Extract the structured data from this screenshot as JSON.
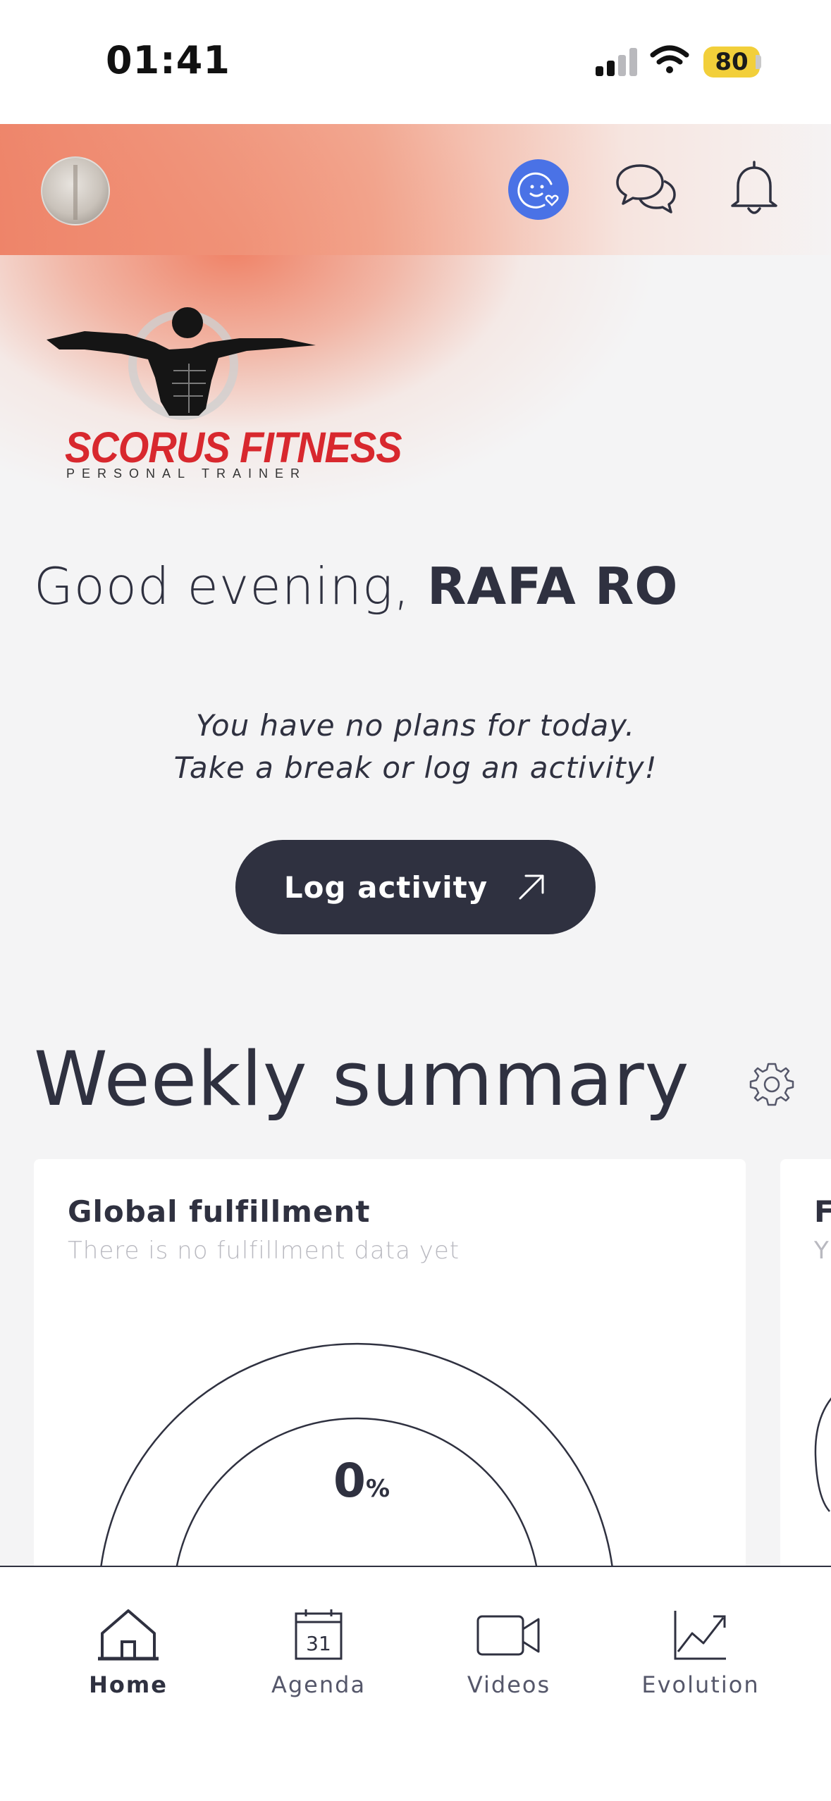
{
  "status_bar": {
    "time": "01:41",
    "battery": "80"
  },
  "header": {
    "avatar": "avatar",
    "mood_icon": "smiley-heart-icon",
    "chat_icon": "chat-bubbles-icon",
    "bell_icon": "bell-icon",
    "brand_color": "#4a72e6"
  },
  "logo": {
    "title": "SCORUS FITNESS",
    "subtitle": "PERSONAL TRAINER",
    "color": "#d8282e"
  },
  "greeting": {
    "prefix": "Good evening, ",
    "name": "RAFA RO"
  },
  "no_plans": {
    "line1": "You have no plans for today.",
    "line2": "Take a break or log an activity!"
  },
  "log_button": {
    "label": "Log activity",
    "icon": "arrow-up-right-icon"
  },
  "weekly": {
    "title": "Weekly summary",
    "settings_icon": "gear-icon",
    "cards": [
      {
        "title": "Global fulfillment",
        "subtitle": "There is no fulfillment data yet",
        "value": "0",
        "unit": "%"
      },
      {
        "title": "F",
        "subtitle": "Y"
      }
    ]
  },
  "tabs": [
    {
      "label": "Home",
      "icon": "home-icon",
      "active": true
    },
    {
      "label": "Agenda",
      "icon": "calendar-icon",
      "day": "31"
    },
    {
      "label": "Videos",
      "icon": "video-camera-icon"
    },
    {
      "label": "Evolution",
      "icon": "trend-chart-icon"
    }
  ]
}
